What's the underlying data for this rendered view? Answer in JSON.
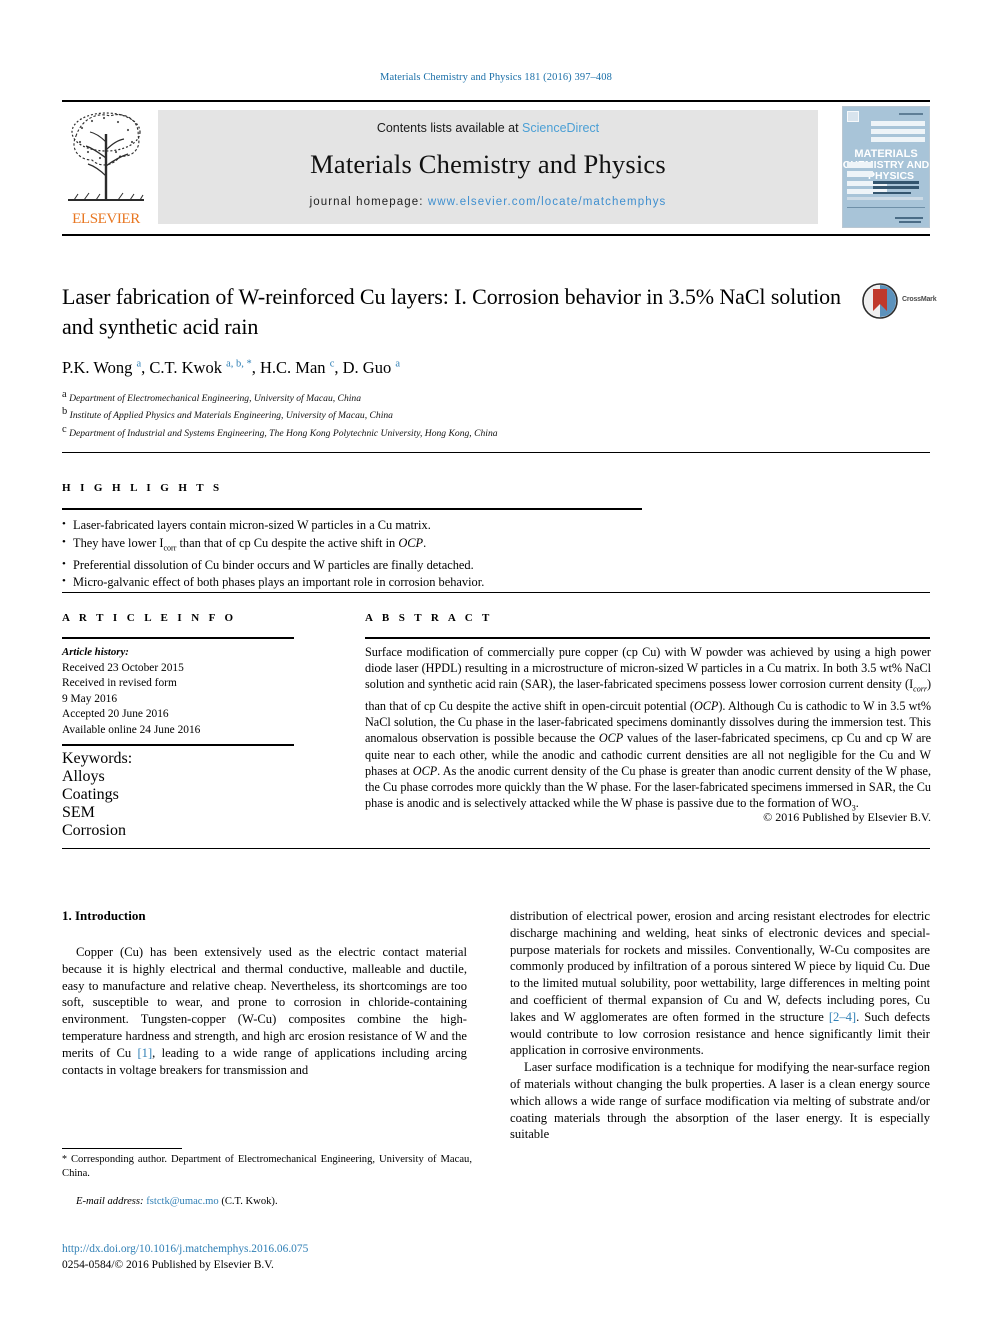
{
  "running_head": "Materials Chemistry and Physics 181 (2016) 397–408",
  "masthead": {
    "publisher": "ELSEVIER",
    "contents_prefix": "Contents lists available at ",
    "contents_link": "ScienceDirect",
    "journal_title": "Materials Chemistry and Physics",
    "homepage_prefix": "journal homepage: ",
    "homepage_url": "www.elsevier.com/locate/matchemphys",
    "cover": {
      "line1": "MATERIALS",
      "line2": "CHEMISTRY AND",
      "line3": "PHYSICS"
    }
  },
  "article": {
    "title": "Laser fabrication of W-reinforced Cu layers: I. Corrosion behavior in 3.5% NaCl solution and synthetic acid rain",
    "crossmark_label": "CrossMark",
    "authors_html": "P.K. Wong <sup>a</sup>, C.T. Kwok <sup>a, b, *</sup>, H.C. Man <sup>c</sup>, D. Guo <sup>a</sup>",
    "affiliations": [
      "<sup>a</sup> Department of Electromechanical Engineering, University of Macau, China",
      "<sup>b</sup> Institute of Applied Physics and Materials Engineering, University of Macau, China",
      "<sup>c</sup> Department of Industrial and Systems Engineering, The Hong Kong Polytechnic University, Hong Kong, China"
    ]
  },
  "highlights": {
    "heading": "H I G H L I G H T S",
    "items": [
      "Laser-fabricated layers contain micron-sized W particles in a Cu matrix.",
      "They have lower I<span class=\"hl-sub\">corr</span> than that of cp Cu despite the active shift in <span class=\"ital\">OCP</span>.",
      "Preferential dissolution of Cu binder occurs and W particles are finally detached.",
      "Micro-galvanic effect of both phases plays an important role in corrosion behavior."
    ]
  },
  "article_info": {
    "heading": "A R T I C L E  I N F O",
    "history_label": "Article history:",
    "history_lines": [
      "Received 23 October 2015",
      "Received in revised form",
      "9 May 2016",
      "Accepted 20 June 2016",
      "Available online 24 June 2016"
    ],
    "keywords_label": "Keywords:",
    "keywords": [
      "Alloys",
      "Coatings",
      "SEM",
      "Corrosion"
    ]
  },
  "abstract": {
    "heading": "A B S T R A C T",
    "text_html": "Surface modification of commercially pure copper (cp Cu) with W powder was achieved by using a high power diode laser (HPDL) resulting in a microstructure of micron-sized W particles in a Cu matrix. In both 3.5 wt% NaCl solution and synthetic acid rain (SAR), the laser-fabricated specimens possess lower corrosion current density (I<sub class=\"it\">corr</sub>) than that of cp Cu despite the active shift in open-circuit potential (<span class=\"it\">OCP</span>). Although Cu is cathodic to W in 3.5 wt% NaCl solution, the Cu phase in the laser-fabricated specimens dominantly dissolves during the immersion test. This anomalous observation is possible because the <span class=\"it\">OCP</span> values of the laser-fabricated specimens, cp Cu and cp W are quite near to each other, while the anodic and cathodic current densities are all not negligible for the Cu and W phases at <span class=\"it\">OCP</span>. As the anodic current density of the Cu phase is greater than anodic current density of the W phase, the Cu phase corrodes more quickly than the W phase. For the laser-fabricated specimens immersed in SAR, the Cu phase is anodic and is selectively attacked while the W phase is passive due to the formation of WO<sub>3</sub>.",
    "copyright": "© 2016 Published by Elsevier B.V."
  },
  "body": {
    "section_number_title": "1.  Introduction",
    "left_paragraph_html": "Copper (Cu) has been extensively used as the electric contact material because it is highly electrical and thermal conductive, malleable and ductile, easy to manufacture and relative cheap. Nevertheless, its shortcomings are too soft, susceptible to wear, and prone to corrosion in chloride-containing environment. Tungsten-copper (W-Cu) composites combine the high-temperature hardness and strength, and high arc erosion resistance of W and the merits of Cu <span class=\"ref-link\">[1]</span>, leading to a wide range of applications including arcing contacts in voltage breakers for transmission and",
    "right_paragraph_1_html": "distribution of electrical power, erosion and arcing resistant electrodes for electric discharge machining and welding, heat sinks of electronic devices and special-purpose materials for rockets and missiles. Conventionally, W-Cu composites are commonly produced by infiltration of a porous sintered W piece by liquid Cu. Due to the limited mutual solubility, poor wettability, large differences in melting point and coefficient of thermal expansion of Cu and W, defects including pores, Cu lakes and W agglomerates are often formed in the structure <span class=\"ref-link\">[2–4]</span>. Such defects would contribute to low corrosion resistance and hence significantly limit their application in corrosive environments.",
    "right_paragraph_2_html": "Laser surface modification is a technique for modifying the near-surface region of materials without changing the bulk properties. A laser is a clean energy source which allows a wide range of surface modification via melting of substrate and/or coating materials through the absorption of the laser energy. It is especially suitable"
  },
  "footer": {
    "corresponding_html": "<span class=\"star\">*</span> Corresponding author. Department of Electromechanical Engineering, University of Macau, China.",
    "email_label": "E-mail address:",
    "email_address": "fstctk@umac.mo",
    "email_suffix": "(C.T. Kwok).",
    "doi": "http://dx.doi.org/10.1016/j.matchemphys.2016.06.075",
    "issn_line": "0254-0584/© 2016 Published by Elsevier B.V."
  },
  "colors": {
    "link_blue": "#2f7fb5",
    "sciencedirect_blue": "#4b9fd5",
    "elsevier_orange": "#e87722",
    "band_gray": "#e4e4e4"
  }
}
